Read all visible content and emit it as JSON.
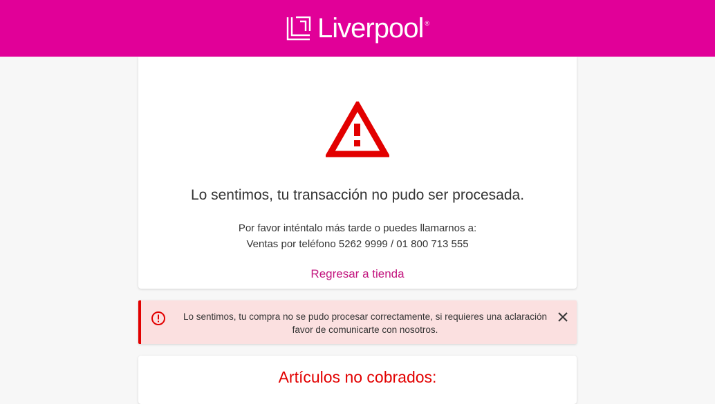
{
  "header": {
    "brand_name": "Liverpool",
    "brand_color": "#e10098"
  },
  "main_card": {
    "icon": "warning-triangle-icon",
    "icon_color": "#e20000",
    "title": "Lo sentimos, tu transacción no pudo ser procesada.",
    "message_line1": "Por favor inténtalo más tarde o puedes llamarnos a:",
    "message_line2": "Ventas por teléfono 5262 9999 / 01 800 713 555",
    "back_link": "Regresar a tienda"
  },
  "alert": {
    "icon": "error-circle-icon",
    "line1": "Lo sentimos, tu compra no se pudo procesar correctamente, si requieres una aclaración",
    "line2": "favor de comunicarte con nosotros.",
    "close_icon": "close-icon"
  },
  "bottom_card": {
    "title": "Artículos no cobrados:"
  }
}
